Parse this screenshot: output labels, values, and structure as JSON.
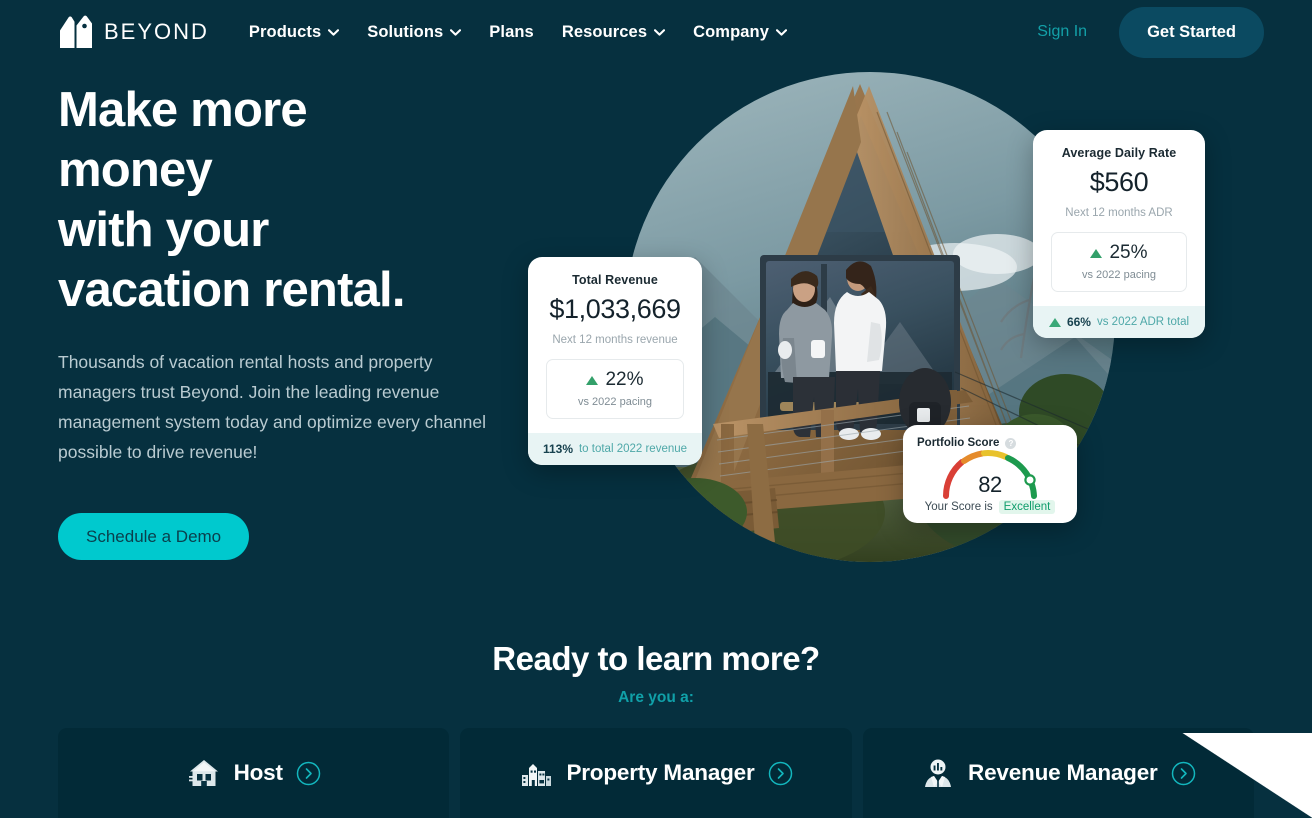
{
  "brand": {
    "name": "BEYOND",
    "logo_icon": "house-tag-logo-icon"
  },
  "colors": {
    "background": "#06303f",
    "accent_teal": "#00c9ce",
    "link_teal": "#13a0a8",
    "button_dark_teal": "#0b4a61",
    "card_dark": "#022a37",
    "positive_green": "#33a06a"
  },
  "nav": {
    "items": [
      {
        "label": "Products",
        "has_dropdown": true
      },
      {
        "label": "Solutions",
        "has_dropdown": true
      },
      {
        "label": "Plans",
        "has_dropdown": false
      },
      {
        "label": "Resources",
        "has_dropdown": true
      },
      {
        "label": "Company",
        "has_dropdown": true
      }
    ],
    "sign_in": "Sign In",
    "get_started": "Get Started"
  },
  "hero": {
    "title_lines": [
      "Make more",
      "money",
      "with your",
      "vacation rental."
    ],
    "paragraph": "Thousands of vacation rental hosts and property managers trust Beyond. Join the leading revenue management system today and optimize every channel possible to drive revenue!",
    "cta": "Schedule a Demo"
  },
  "metric_cards": {
    "revenue": {
      "title": "Total Revenue",
      "value": "$1,033,669",
      "label": "Next 12 months revenue",
      "delta_value": "22%",
      "delta_sub": "vs 2022 pacing",
      "footer_strong": "113%",
      "footer_text": "to total 2022 revenue"
    },
    "adr": {
      "title": "Average Daily Rate",
      "value": "$560",
      "label": "Next 12 months ADR",
      "delta_value": "25%",
      "delta_sub": "vs 2022 pacing",
      "footer_strong": "66%",
      "footer_text": "vs 2022 ADR total"
    },
    "portfolio_score": {
      "title": "Portfolio Score",
      "score": "82",
      "footer_text": "Your Score is",
      "rating": "Excellent",
      "info_glyph": "?"
    }
  },
  "learn_more": {
    "title": "Ready to learn more?",
    "subtitle": "Are you a:",
    "personas": [
      {
        "label": "Host",
        "icon": "house-icon"
      },
      {
        "label": "Property Manager",
        "icon": "buildings-icon"
      },
      {
        "label": "Revenue Manager",
        "icon": "analyst-person-icon"
      }
    ]
  }
}
